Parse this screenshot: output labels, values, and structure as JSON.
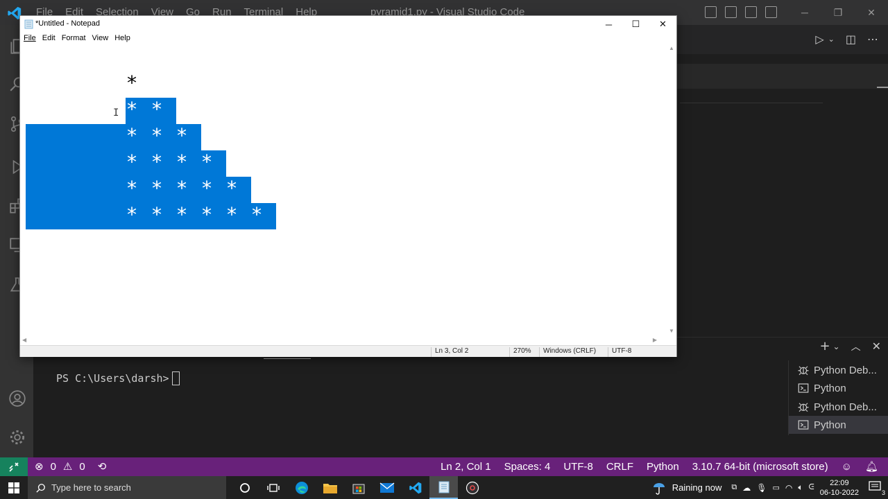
{
  "vscode": {
    "menu": [
      "File",
      "Edit",
      "Selection",
      "View",
      "Go",
      "Run",
      "Terminal",
      "Help"
    ],
    "title": "pyramid1.py - Visual Studio Code"
  },
  "notepad": {
    "title": "*Untitled - Notepad",
    "menu": [
      "File",
      "Edit",
      "Format",
      "View",
      "Help"
    ],
    "lines": [
      [
        "*"
      ],
      [
        "*",
        "*"
      ],
      [
        "*",
        "*",
        "*"
      ],
      [
        "*",
        "*",
        "*",
        "*"
      ],
      [
        "*",
        "*",
        "*",
        "*",
        "*"
      ],
      [
        "*",
        "*",
        "*",
        "*",
        "*",
        "*"
      ]
    ],
    "status": {
      "position": "Ln 3, Col 2",
      "zoom": "270%",
      "line_endings": "Windows (CRLF)",
      "encoding": "UTF-8"
    }
  },
  "terminal": {
    "prompt": "PS C:\\Users\\darsh>",
    "sessions": [
      {
        "icon": "debug-icon",
        "label": "Python Deb..."
      },
      {
        "icon": "terminal-icon",
        "label": "Python"
      },
      {
        "icon": "debug-icon",
        "label": "Python Deb..."
      },
      {
        "icon": "terminal-icon",
        "label": "Python",
        "active": true
      }
    ]
  },
  "statusbar": {
    "errors": "0",
    "warnings": "0",
    "cursor": "Ln 2, Col 1",
    "spaces": "Spaces: 4",
    "encoding": "UTF-8",
    "eol": "CRLF",
    "language": "Python",
    "interpreter": "3.10.7 64-bit (microsoft store)"
  },
  "taskbar": {
    "search_placeholder": "Type here to search",
    "weather": "Raining now",
    "time": "22:09",
    "date": "06-10-2022",
    "notification_count": "3"
  },
  "colors": {
    "selection": "#0078d7",
    "statusbar": "#68217a",
    "remote": "#16825d"
  }
}
